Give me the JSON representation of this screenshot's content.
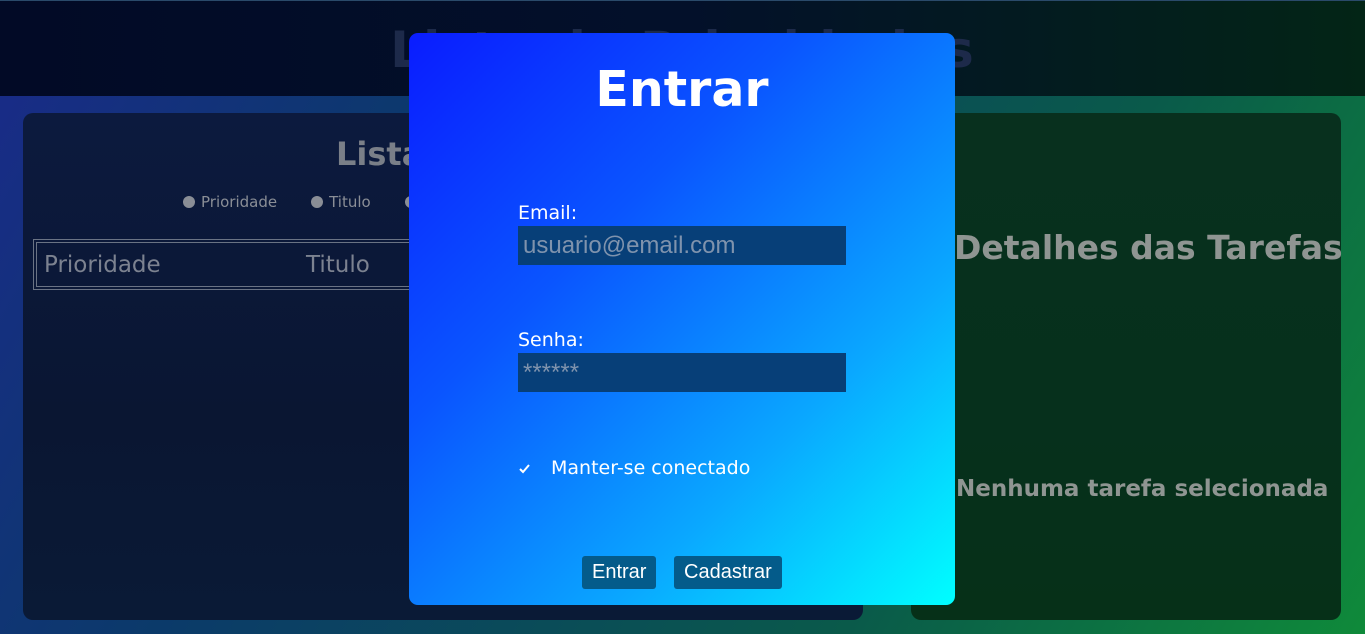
{
  "app": {
    "title": "Lista de Prioridades"
  },
  "list_panel": {
    "title": "Lista",
    "sort_options": [
      "Prioridade",
      "Titulo",
      ""
    ],
    "columns": [
      "Prioridade",
      "Titulo"
    ]
  },
  "details_panel": {
    "title": "Detalhes das Tarefas",
    "empty_message": "Nenhuma tarefa selecionada"
  },
  "login_modal": {
    "title": "Entrar",
    "email_label": "Email:",
    "email_placeholder": "usuario@email.com",
    "password_label": "Senha:",
    "password_placeholder": "******",
    "remember_label": "Manter-se conectado",
    "remember_checked": true,
    "login_button": "Entrar",
    "register_button": "Cadastrar"
  },
  "colors": {
    "modal_gradient_start": "#0a1cff",
    "modal_gradient_end": "#00ffff",
    "input_bg": "#073f78",
    "button_bg": "#045b8a"
  }
}
